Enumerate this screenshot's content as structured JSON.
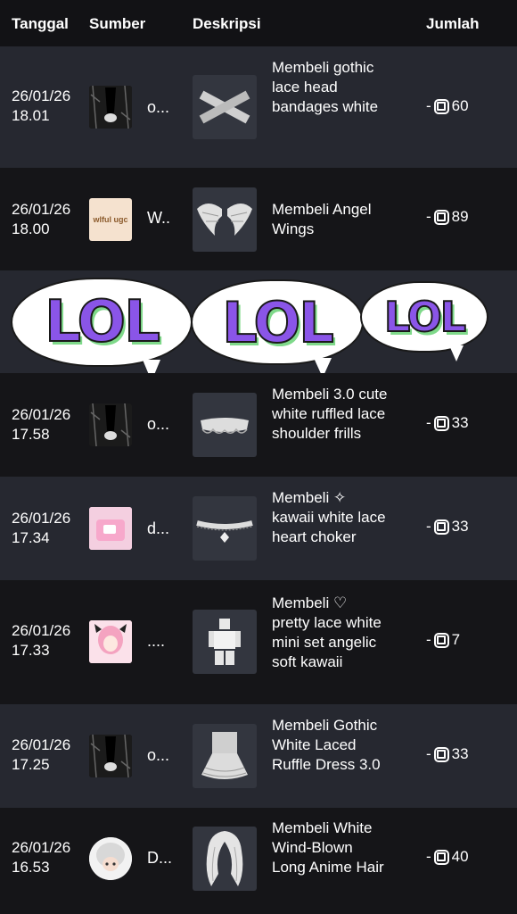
{
  "header": {
    "date": "Tanggal",
    "source": "Sumber",
    "description": "Deskripsi",
    "amount": "Jumlah"
  },
  "overlay": {
    "text": "LOL"
  },
  "rows": [
    {
      "date": "26/01/26",
      "time": "18.01",
      "source": "o...",
      "desc": "Membeli gothic lace head bandages white",
      "amount": "60",
      "sign": "-"
    },
    {
      "date": "26/01/26",
      "time": "18.00",
      "source": "W..",
      "desc": "Membeli Angel Wings",
      "amount": "89",
      "sign": "-",
      "logo": "wlful ugc"
    },
    {
      "date": "26/01/26",
      "time": "17.58",
      "source": "o...",
      "desc": "Membeli 3.0 cute white ruffled lace shoulder frills",
      "amount": "33",
      "sign": "-"
    },
    {
      "date": "26/01/26",
      "time": "17.34",
      "source": "d...",
      "desc": "Membeli ✧ kawaii white lace heart choker",
      "amount": "33",
      "sign": "-"
    },
    {
      "date": "26/01/26",
      "time": "17.33",
      "source": "....",
      "desc": "Membeli ♡ pretty lace white mini set angelic soft kawaii",
      "amount": "7",
      "sign": "-"
    },
    {
      "date": "26/01/26",
      "time": "17.25",
      "source": "o...",
      "desc": "Membeli Gothic White Laced Ruffle Dress 3.0",
      "amount": "33",
      "sign": "-"
    },
    {
      "date": "26/01/26",
      "time": "16.53",
      "source": "D...",
      "desc": "Membeli White Wind-Blown Long Anime Hair",
      "amount": "40",
      "sign": "-"
    }
  ]
}
